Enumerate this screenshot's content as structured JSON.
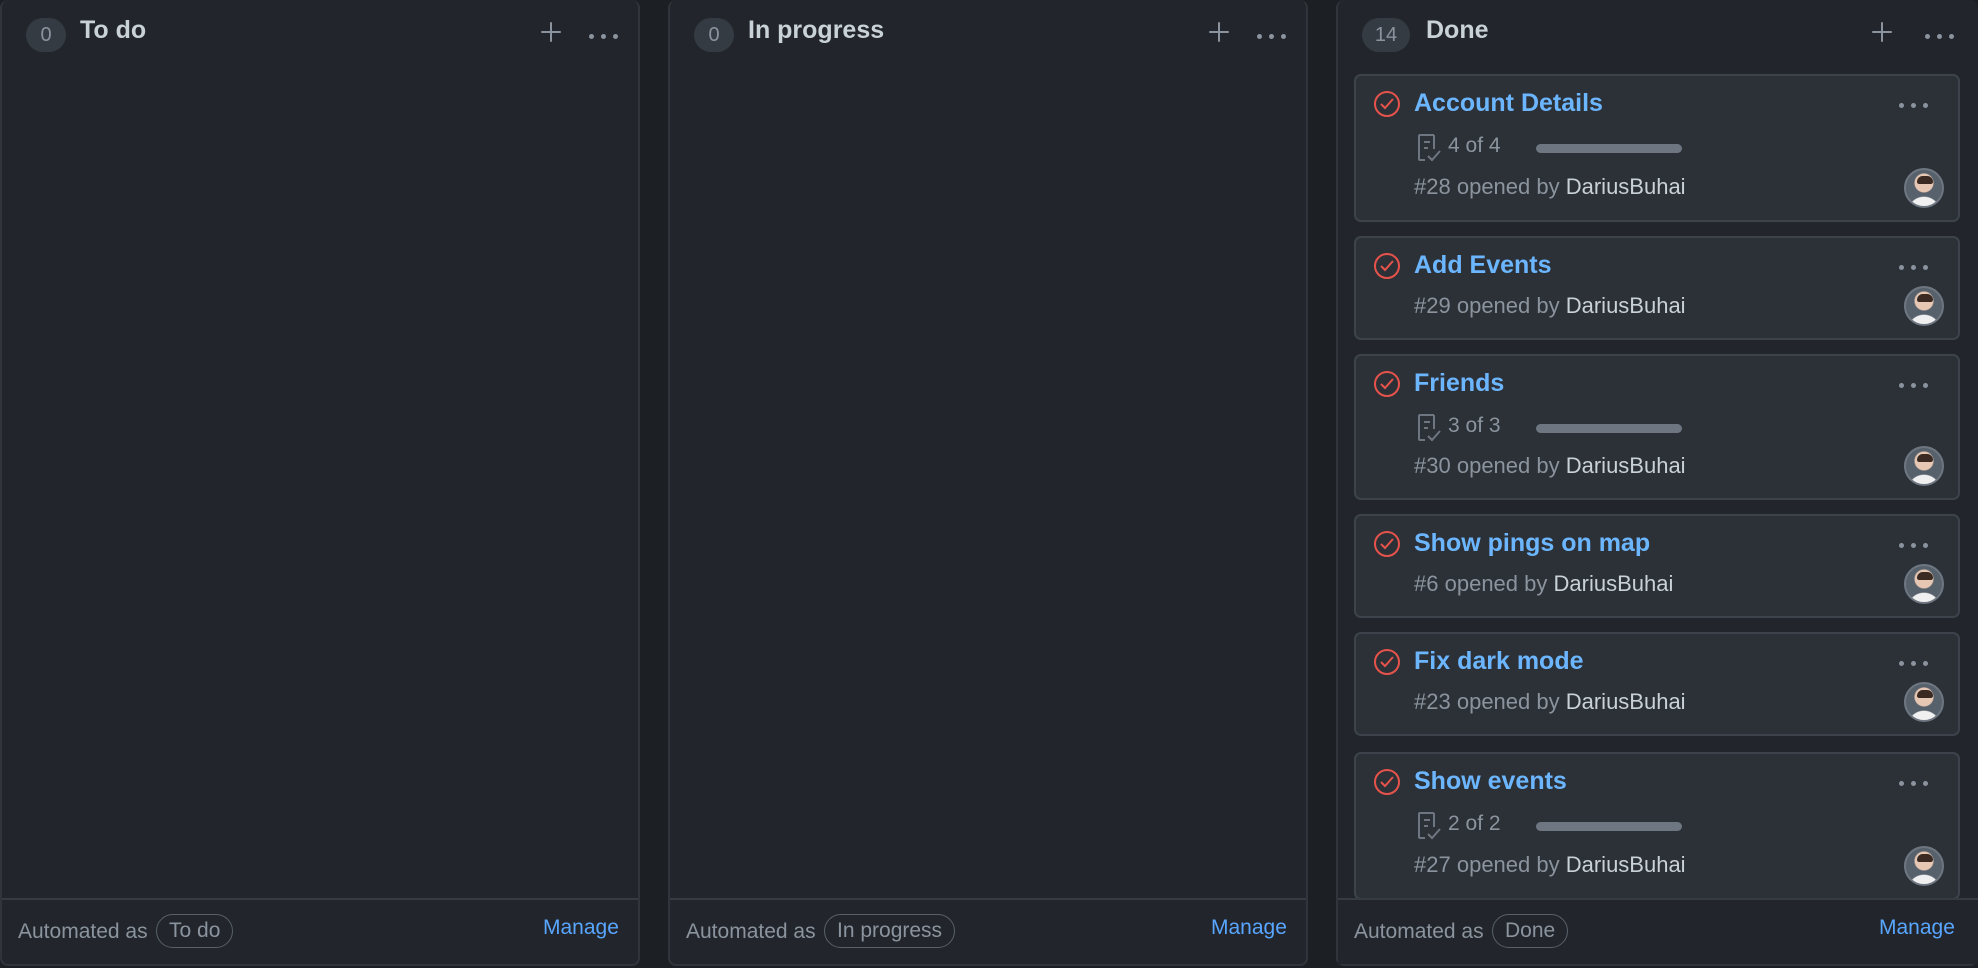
{
  "columns": [
    {
      "title": "To do",
      "count": "0",
      "automated_label": "Automated as",
      "automation": "To do",
      "manage": "Manage"
    },
    {
      "title": "In progress",
      "count": "0",
      "automated_label": "Automated as",
      "automation": "In progress",
      "manage": "Manage"
    },
    {
      "title": "Done",
      "count": "14",
      "automated_label": "Automated as",
      "automation": "Done",
      "manage": "Manage"
    }
  ],
  "cards": [
    {
      "title": "Account Details",
      "progress": "4 of 4",
      "progress_fraction": 1,
      "number": "#28",
      "opened_by": "opened by",
      "author": "DariusBuhai"
    },
    {
      "title": "Add Events",
      "number": "#29",
      "opened_by": "opened by",
      "author": "DariusBuhai"
    },
    {
      "title": "Friends",
      "progress": "3 of 3",
      "progress_fraction": 1,
      "number": "#30",
      "opened_by": "opened by",
      "author": "DariusBuhai"
    },
    {
      "title": "Show pings on map",
      "number": "#6",
      "opened_by": "opened by",
      "author": "DariusBuhai"
    },
    {
      "title": "Fix dark mode",
      "number": "#23",
      "opened_by": "opened by",
      "author": "DariusBuhai"
    },
    {
      "title": "Show events",
      "progress": "2 of 2",
      "progress_fraction": 1,
      "number": "#27",
      "opened_by": "opened by",
      "author": "DariusBuhai"
    }
  ],
  "colors": {
    "issue_closed": "#e5534b",
    "link": "#6cb6ff",
    "accent": "#58a6ff"
  },
  "icons": {
    "card_status": "issue-closed-icon",
    "progress": "checklist-icon",
    "add": "plus-icon",
    "more": "kebab-icon"
  }
}
